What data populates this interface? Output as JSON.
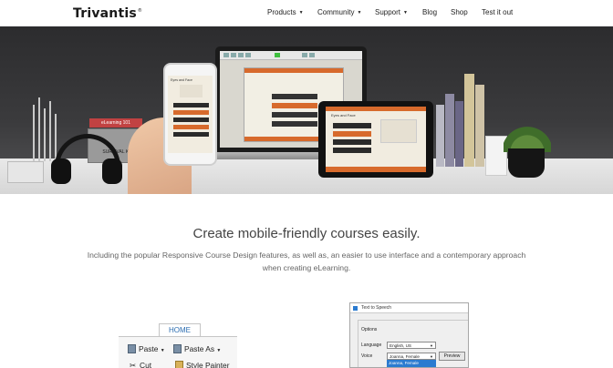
{
  "header": {
    "logo": "Trivantis",
    "logo_mark": "®",
    "nav": [
      {
        "label": "Products",
        "caret": "▼"
      },
      {
        "label": "Community",
        "caret": "▼"
      },
      {
        "label": "Support",
        "caret": "▼"
      },
      {
        "label": "Blog"
      },
      {
        "label": "Shop"
      },
      {
        "label": "Test it out"
      }
    ]
  },
  "hero": {
    "box_label": "eLearning 101",
    "kit_label": "SURVIVAL KIT",
    "course_title": "Eyes and Face"
  },
  "content": {
    "headline": "Create mobile-friendly courses easily.",
    "subtext": "Including the popular Responsive Course Design features, as well as, an easier to use interface and a contemporary approach when creating eLearning."
  },
  "ribbon": {
    "tab": "HOME",
    "paste": "Paste",
    "paste_as": "Paste As",
    "cut": "Cut",
    "style_painter": "Style Painter"
  },
  "tts_dialog": {
    "title": "Text to Speech",
    "group": "Options",
    "language_label": "Language",
    "language_value": "English, US",
    "voice_label": "Voice",
    "voice_value": "Joanna, Female",
    "preview": "Preview",
    "highlighted_option": "Joanna, Female"
  }
}
